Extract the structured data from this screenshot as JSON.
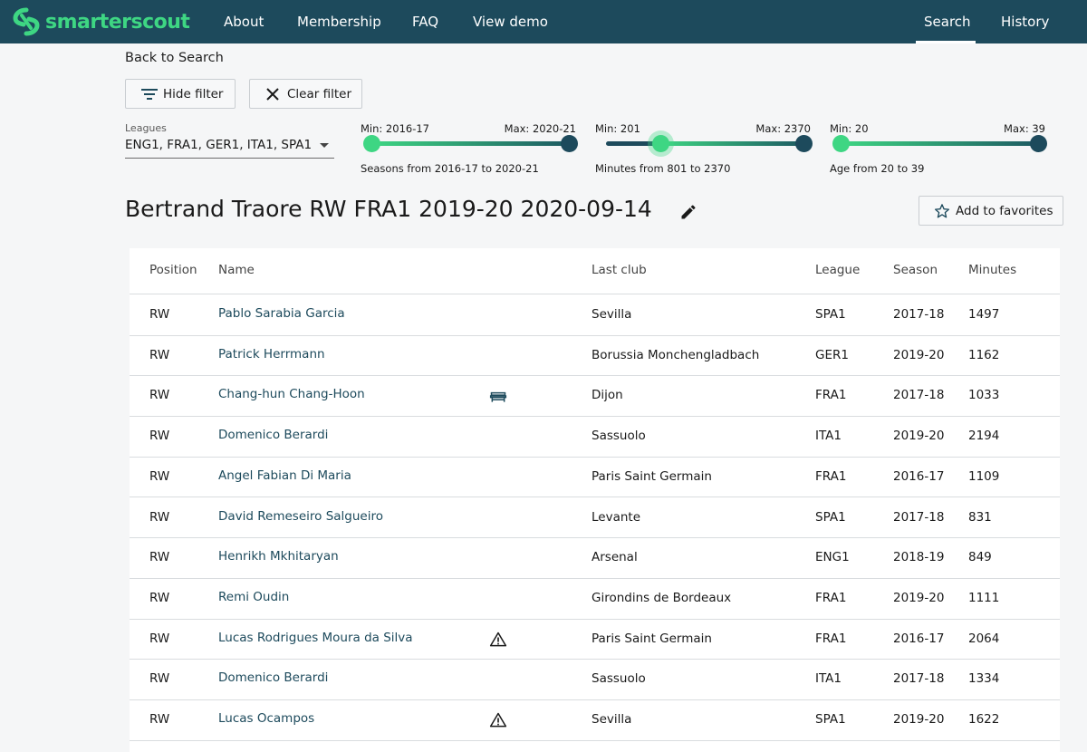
{
  "brand": {
    "name": "smarterscout",
    "accent": "#3ed683",
    "nav_bg": "#1d4a5c"
  },
  "nav": {
    "left": [
      "About",
      "Membership",
      "FAQ",
      "View demo"
    ],
    "right": [
      "Search",
      "History"
    ],
    "active": "Search"
  },
  "back_link": "Back to Search",
  "filter_buttons": {
    "hide": "Hide filter",
    "clear": "Clear filter"
  },
  "leagues": {
    "label": "Leagues",
    "value": "ENG1, FRA1, GER1, ITA1, SPA1"
  },
  "sliders": [
    {
      "min_label": "Min: 2016-17",
      "max_label": "Max: 2020-21",
      "caption": "Seasons from 2016-17 to 2020-21",
      "low": 0.0,
      "high": 1.0
    },
    {
      "min_label": "Min: 201",
      "max_label": "Max: 2370",
      "caption": "Minutes from 801 to 2370",
      "low": 0.277,
      "high": 1.0
    },
    {
      "min_label": "Min: 20",
      "max_label": "Max: 39",
      "caption": "Age from 20 to 39",
      "low": 0.0,
      "high": 1.0
    }
  ],
  "title": "Bertrand Traore RW FRA1 2019-20 2020-09-14",
  "favorites_label": "Add to favorites",
  "table": {
    "headers": {
      "position": "Position",
      "name": "Name",
      "last_club": "Last club",
      "league": "League",
      "season": "Season",
      "minutes": "Minutes"
    },
    "rows": [
      {
        "position": "RW",
        "name": "Pablo Sarabia Garcia",
        "icon": "",
        "club": "Sevilla",
        "league": "SPA1",
        "season": "2017-18",
        "minutes": "1497"
      },
      {
        "position": "RW",
        "name": "Patrick Herrmann",
        "icon": "",
        "club": "Borussia Monchengladbach",
        "league": "GER1",
        "season": "2019-20",
        "minutes": "1162"
      },
      {
        "position": "RW",
        "name": "Chang-hun Chang-Hoon",
        "icon": "bench-icon",
        "club": "Dijon",
        "league": "FRA1",
        "season": "2017-18",
        "minutes": "1033"
      },
      {
        "position": "RW",
        "name": "Domenico Berardi",
        "icon": "",
        "club": "Sassuolo",
        "league": "ITA1",
        "season": "2019-20",
        "minutes": "2194"
      },
      {
        "position": "RW",
        "name": "Angel Fabian Di Maria",
        "icon": "",
        "club": "Paris Saint Germain",
        "league": "FRA1",
        "season": "2016-17",
        "minutes": "1109"
      },
      {
        "position": "RW",
        "name": "David Remeseiro Salgueiro",
        "icon": "",
        "club": "Levante",
        "league": "SPA1",
        "season": "2017-18",
        "minutes": "831"
      },
      {
        "position": "RW",
        "name": "Henrikh Mkhitaryan",
        "icon": "",
        "club": "Arsenal",
        "league": "ENG1",
        "season": "2018-19",
        "minutes": "849"
      },
      {
        "position": "RW",
        "name": "Remi Oudin",
        "icon": "",
        "club": "Girondins de Bordeaux",
        "league": "FRA1",
        "season": "2019-20",
        "minutes": "1111"
      },
      {
        "position": "RW",
        "name": "Lucas Rodrigues Moura da Silva",
        "icon": "warning-icon",
        "club": "Paris Saint Germain",
        "league": "FRA1",
        "season": "2016-17",
        "minutes": "2064"
      },
      {
        "position": "RW",
        "name": "Domenico Berardi",
        "icon": "",
        "club": "Sassuolo",
        "league": "ITA1",
        "season": "2017-18",
        "minutes": "1334"
      },
      {
        "position": "RW",
        "name": "Lucas Ocampos",
        "icon": "warning-icon",
        "club": "Sevilla",
        "league": "SPA1",
        "season": "2019-20",
        "minutes": "1622"
      }
    ]
  }
}
